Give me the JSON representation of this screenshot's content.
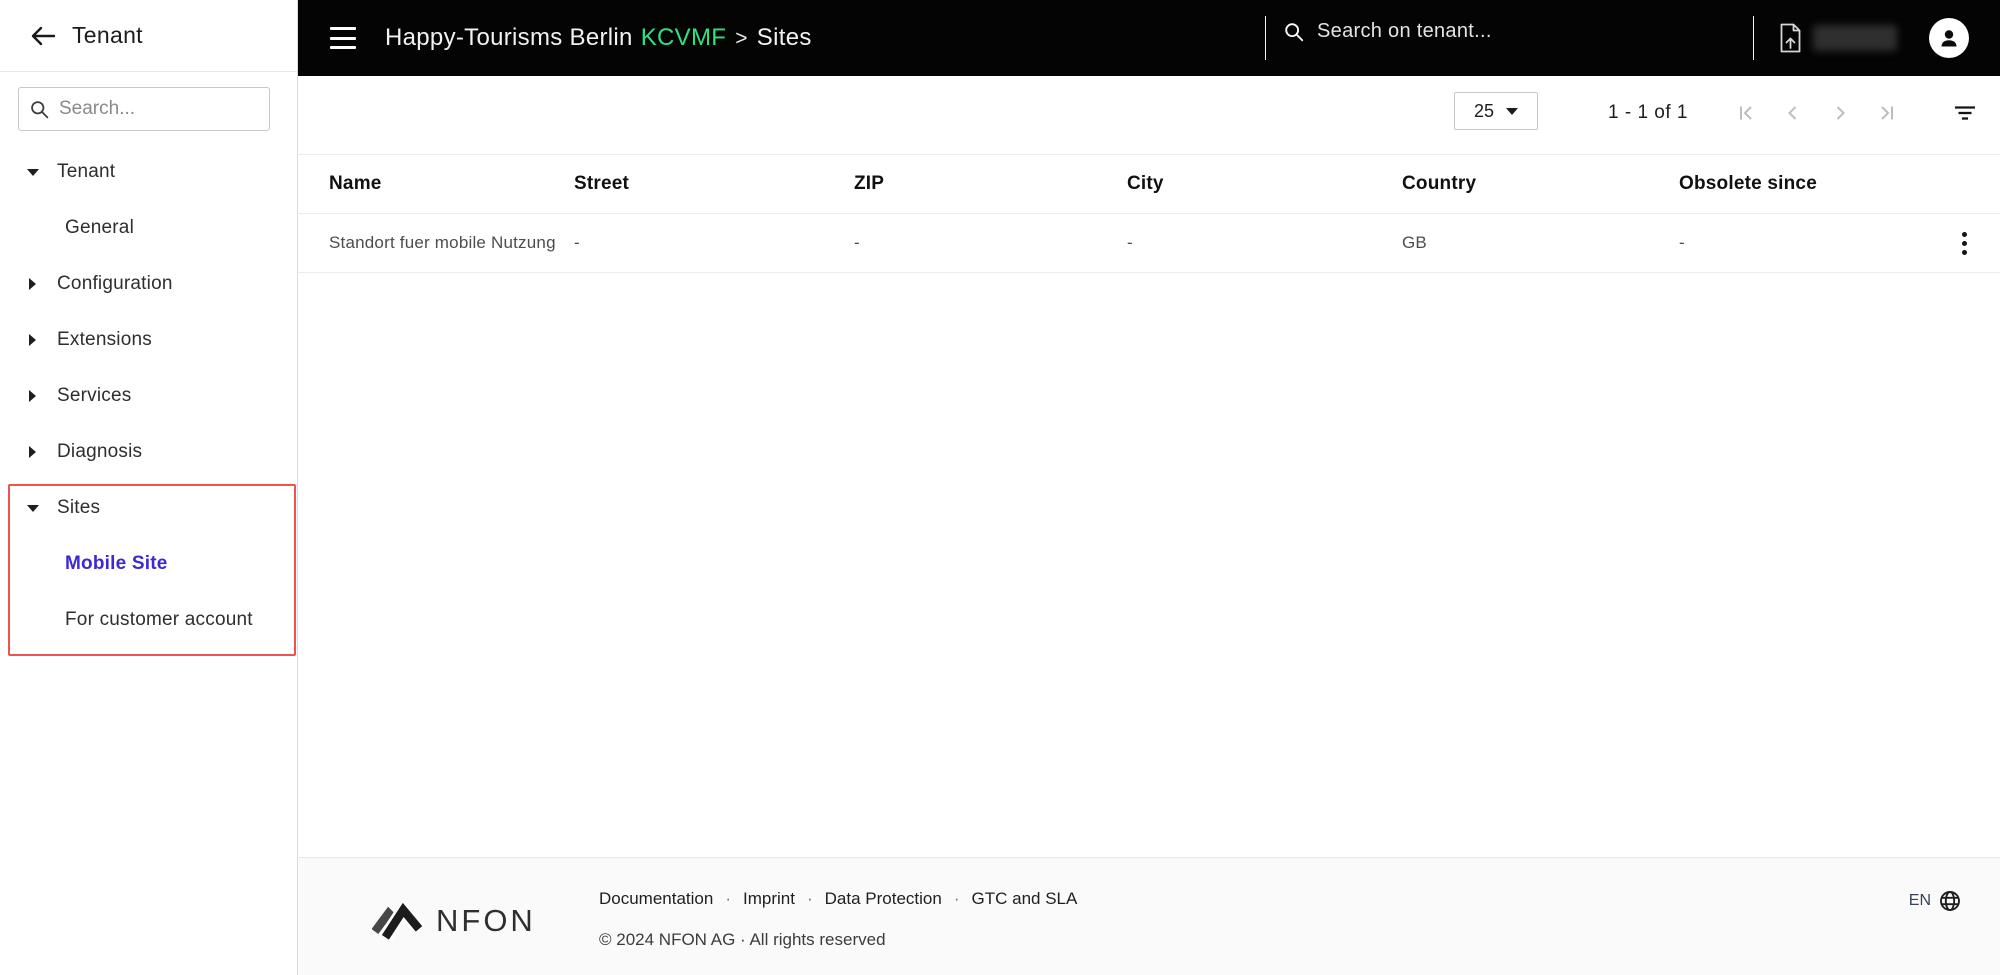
{
  "sidebar": {
    "title": "Tenant",
    "search_placeholder": "Search...",
    "items": [
      {
        "label": "Tenant",
        "level": 1,
        "state": "expanded",
        "selected": false
      },
      {
        "label": "General",
        "level": 2,
        "state": "none",
        "selected": false
      },
      {
        "label": "Configuration",
        "level": 1,
        "state": "collapsed",
        "selected": false
      },
      {
        "label": "Extensions",
        "level": 1,
        "state": "collapsed",
        "selected": false
      },
      {
        "label": "Services",
        "level": 1,
        "state": "collapsed",
        "selected": false
      },
      {
        "label": "Diagnosis",
        "level": 1,
        "state": "collapsed",
        "selected": false
      },
      {
        "label": "Sites",
        "level": 1,
        "state": "expanded",
        "selected": false
      },
      {
        "label": "Mobile Site",
        "level": 2,
        "state": "none",
        "selected": true
      },
      {
        "label": "For customer account",
        "level": 2,
        "state": "none",
        "selected": false
      }
    ]
  },
  "header": {
    "breadcrumb": {
      "tenant": "Happy-Tourisms Berlin",
      "code": "KCVMF",
      "separator": ">",
      "page": "Sites"
    },
    "search_placeholder": "Search on tenant..."
  },
  "toolbar": {
    "page_size": "25",
    "range": "1 - 1 of 1",
    "pager_disabled": true
  },
  "table": {
    "columns": [
      "Name",
      "Street",
      "ZIP",
      "City",
      "Country",
      "Obsolete since"
    ],
    "rows": [
      [
        "Standort fuer mobile Nutzung",
        "-",
        "-",
        "-",
        "GB",
        "-"
      ]
    ]
  },
  "footer": {
    "brand": "NFON",
    "links": [
      "Documentation",
      "Imprint",
      "Data Protection",
      "GTC and SLA"
    ],
    "link_separator": "·",
    "copyright": "© 2024 NFON AG · All rights reserved",
    "language": "EN"
  },
  "icons": {
    "back": "left-arrow",
    "search": "magnifier",
    "menu": "hamburger",
    "export": "page-upload-arrow",
    "user": "person-avatar",
    "pager": [
      "first-page",
      "chevron-left",
      "chevron-right",
      "last-page"
    ],
    "filter": "filter-lines",
    "row_menu": "kebab-vertical-dots",
    "language": "globe"
  },
  "colors": {
    "accent_green": "#2ee27d",
    "link_purple": "#3b28d6",
    "highlight_red": "#f0524d",
    "header_bg": "#040404"
  }
}
